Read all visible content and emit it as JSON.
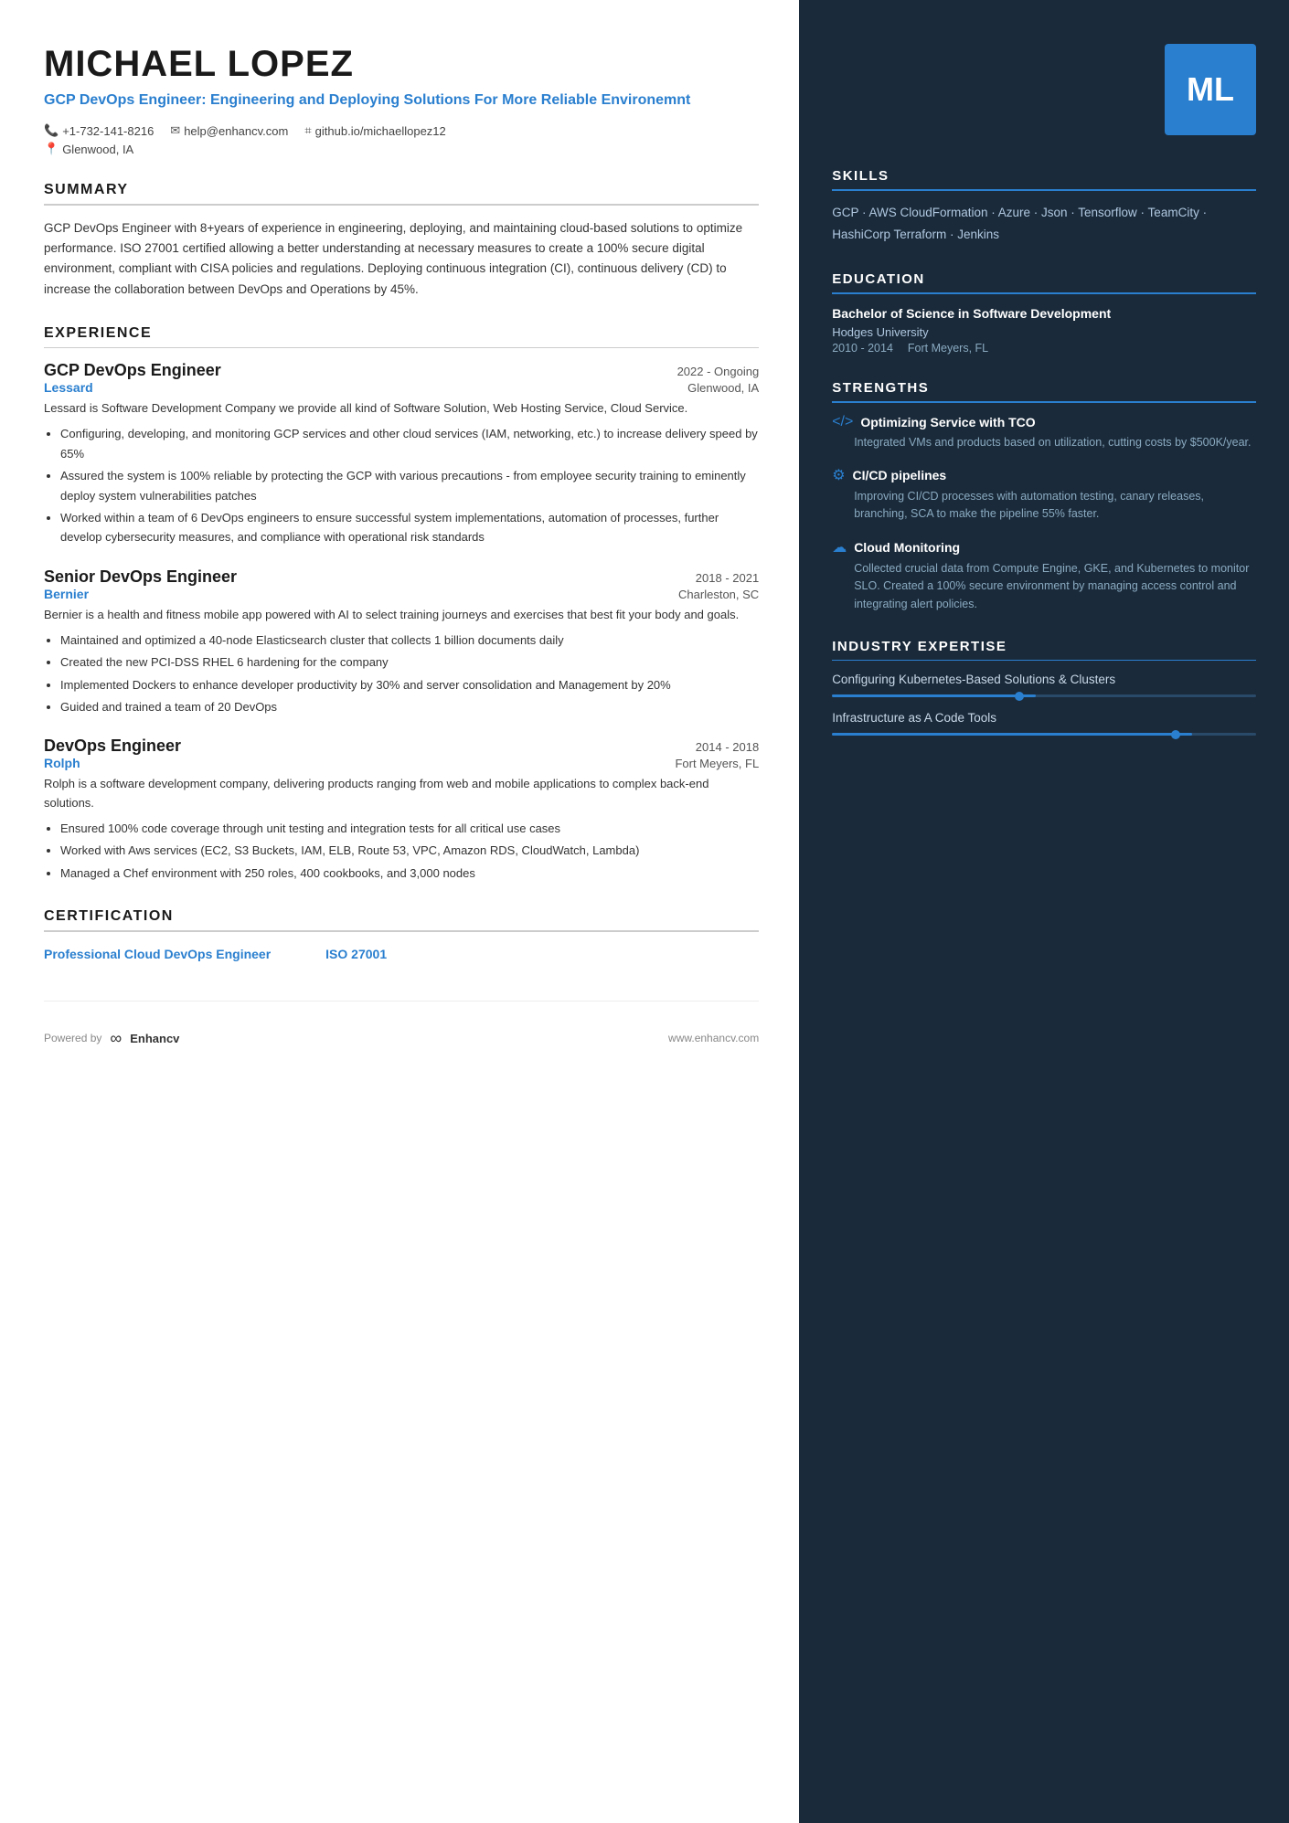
{
  "resume": {
    "name": "MICHAEL LOPEZ",
    "title": "GCP DevOps Engineer: Engineering and Deploying Solutions For More Reliable Environemnt",
    "contact": {
      "phone": "+1-732-141-8216",
      "email": "help@enhancv.com",
      "github": "github.io/michaellopez12",
      "location": "Glenwood, IA"
    },
    "avatar_initials": "ML",
    "summary": "GCP DevOps Engineer with 8+years of experience in engineering, deploying, and maintaining cloud-based solutions to optimize performance. ISO 27001 certified allowing a better understanding at necessary measures to create a 100% secure digital environment, compliant with CISA policies and regulations. Deploying continuous integration (CI), continuous delivery (CD) to increase the collaboration between DevOps and Operations by 45%.",
    "sections": {
      "summary_label": "SUMMARY",
      "experience_label": "EXPERIENCE",
      "certification_label": "CERTIFICATION"
    },
    "experience": [
      {
        "title": "GCP DevOps Engineer",
        "dates": "2022 - Ongoing",
        "company": "Lessard",
        "location": "Glenwood, IA",
        "description": "Lessard is Software Development Company we provide all kind of Software Solution, Web Hosting Service, Cloud Service.",
        "bullets": [
          "Configuring, developing, and monitoring GCP services and other cloud services (IAM, networking, etc.) to increase delivery speed by 65%",
          "Assured the system is 100% reliable by protecting the GCP with various precautions - from employee security training to eminently deploy system vulnerabilities patches",
          "Worked within a team of 6 DevOps engineers to ensure successful system implementations, automation of processes, further develop cybersecurity measures, and compliance with operational risk standards"
        ]
      },
      {
        "title": "Senior DevOps Engineer",
        "dates": "2018 - 2021",
        "company": "Bernier",
        "location": "Charleston, SC",
        "description": "Bernier is a health and fitness mobile app powered with AI to select training journeys and exercises that best fit your body and goals.",
        "bullets": [
          "Maintained and optimized a 40-node Elasticsearch cluster that collects 1 billion documents daily",
          "Created the new PCI-DSS RHEL 6 hardening for the company",
          "Implemented Dockers to enhance developer productivity by 30% and server consolidation and Management by 20%",
          "Guided and trained a team of 20 DevOps"
        ]
      },
      {
        "title": "DevOps Engineer",
        "dates": "2014 - 2018",
        "company": "Rolph",
        "location": "Fort Meyers, FL",
        "description": "Rolph is a software development company, delivering products ranging from web and mobile applications to complex back-end solutions.",
        "bullets": [
          "Ensured 100% code coverage through unit testing and integration tests for all critical use cases",
          "Worked with Aws services (EC2, S3 Buckets, IAM, ELB, Route 53, VPC, Amazon RDS, CloudWatch, Lambda)",
          "Managed a Chef environment with 250 roles, 400 cookbooks, and 3,000 nodes"
        ]
      }
    ],
    "certifications": [
      {
        "name": "Professional Cloud DevOps Engineer"
      },
      {
        "name": "ISO 27001"
      }
    ],
    "footer": {
      "powered_by": "Powered by",
      "brand": "Enhancv",
      "website": "www.enhancv.com"
    }
  },
  "sidebar": {
    "skills_label": "SKILLS",
    "skills_text": "GCP · AWS CloudFormation · Azure · Json · Tensorflow · TeamCity · HashiCorp Terraform · Jenkins",
    "education_label": "EDUCATION",
    "education": [
      {
        "degree": "Bachelor of Science in Software Development",
        "school": "Hodges University",
        "years": "2010 - 2014",
        "location": "Fort Meyers, FL"
      }
    ],
    "strengths_label": "STRENGTHS",
    "strengths": [
      {
        "icon": "</> ",
        "name": "Optimizing Service with TCO",
        "desc": "Integrated VMs and products based on utilization, cutting costs by $500K/year."
      },
      {
        "icon": "⚙",
        "name": "CI/CD pipelines",
        "desc": "Improving CI/CD processes with automation testing, canary releases, branching, SCA to make the pipeline 55% faster."
      },
      {
        "icon": "☁",
        "name": "Cloud Monitoring",
        "desc": "Collected crucial data from Compute Engine, GKE, and Kubernetes to monitor SLO. Created a 100% secure environment by managing access control and integrating alert policies."
      }
    ],
    "expertise_label": "INDUSTRY EXPERTISE",
    "expertise": [
      {
        "name": "Configuring Kubernetes-Based Solutions & Clusters",
        "fill_pct": 48
      },
      {
        "name": "Infrastructure as A Code Tools",
        "fill_pct": 85
      }
    ]
  }
}
